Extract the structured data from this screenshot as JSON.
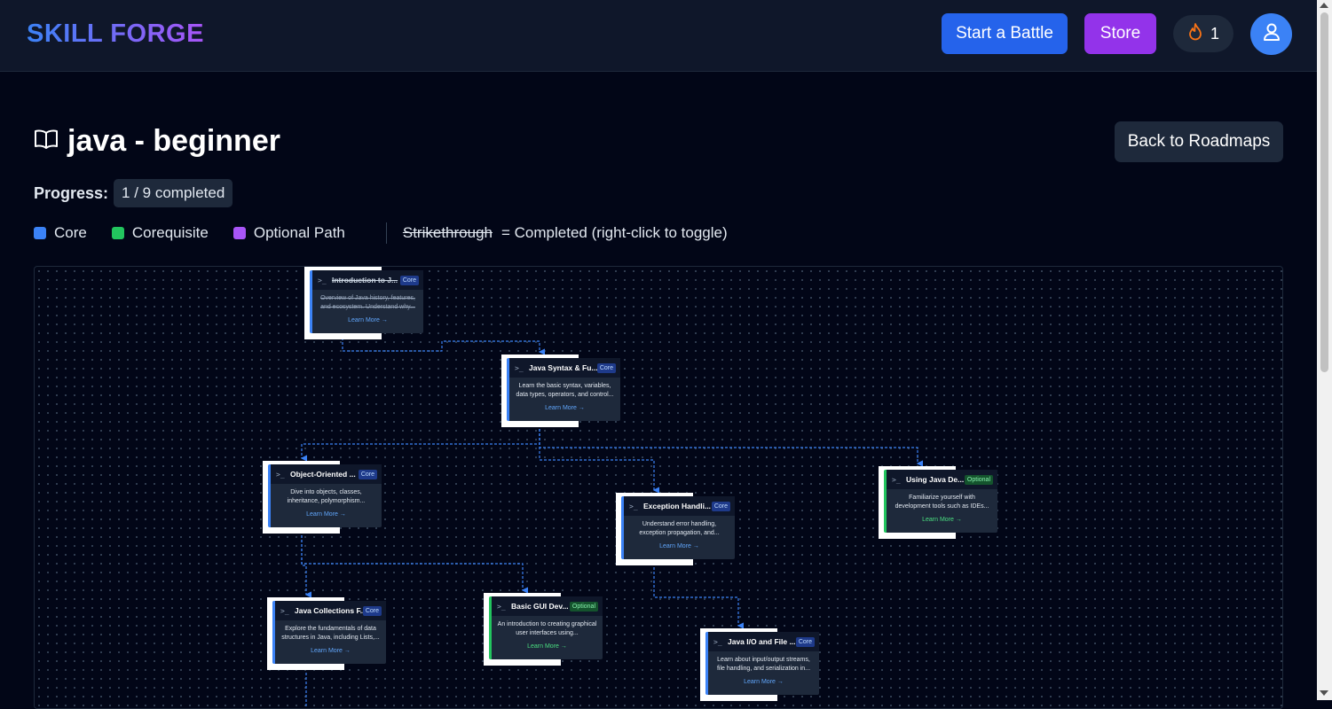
{
  "header": {
    "logo": "SKILL FORGE",
    "battle_label": "Start a Battle",
    "store_label": "Store",
    "streak_count": "1",
    "streak_icon": "flame-icon",
    "avatar_icon": "user-icon"
  },
  "page": {
    "title": "java - beginner",
    "title_icon": "book-open-icon",
    "back_label": "Back to Roadmaps",
    "progress_label": "Progress:",
    "progress_value": "1 / 9 completed"
  },
  "legend": {
    "core": "Core",
    "corequisite": "Corequisite",
    "optional": "Optional Path",
    "strike_word": "Strikethrough",
    "strike_desc": "= Completed (right-click to toggle)",
    "colors": {
      "core": "#3b82f6",
      "corequisite": "#22c55e",
      "optional": "#a855f7"
    }
  },
  "nodes": [
    {
      "title": "Introduction to J...",
      "tag": "Core",
      "desc": "Overview of Java history, features, and ecosystem. Understand why...",
      "link": "Learn More →",
      "completed": true
    },
    {
      "title": "Java Syntax & Fu...",
      "tag": "Core",
      "desc": "Learn the basic syntax, variables, data types, operators, and control...",
      "link": "Learn More →",
      "completed": false
    },
    {
      "title": "Object-Oriented ...",
      "tag": "Core",
      "desc": "Dive into objects, classes, inheritance, polymorphism...",
      "link": "Learn More →",
      "completed": false
    },
    {
      "title": "Exception Handli...",
      "tag": "Core",
      "desc": "Understand error handling, exception propagation, and...",
      "link": "Learn More →",
      "completed": false
    },
    {
      "title": "Using Java De...",
      "tag": "Optional",
      "desc": "Familiarize yourself with development tools such as IDEs...",
      "link": "Learn More →",
      "completed": false
    },
    {
      "title": "Java Collections F...",
      "tag": "Core",
      "desc": "Explore the fundamentals of data structures in Java, including Lists,...",
      "link": "Learn More →",
      "completed": false
    },
    {
      "title": "Basic GUI Dev...",
      "tag": "Optional",
      "desc": "An introduction to creating graphical user interfaces using...",
      "link": "Learn More →",
      "completed": false
    },
    {
      "title": "Java I/O and File ...",
      "tag": "Core",
      "desc": "Learn about input/output streams, file handling, and serialization in...",
      "link": "Learn More →",
      "completed": false
    }
  ]
}
